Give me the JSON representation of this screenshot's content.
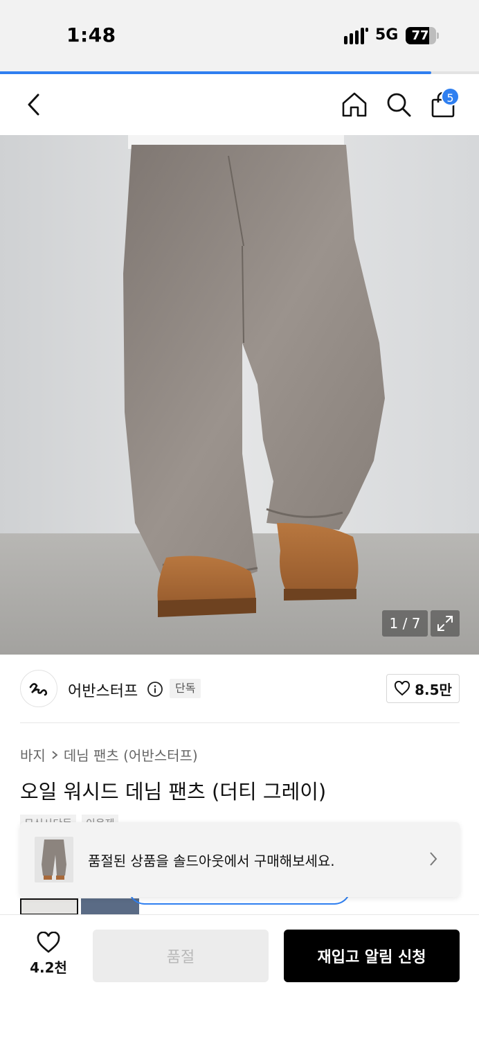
{
  "status_bar": {
    "time": "1:48",
    "network": "5G",
    "battery": "77"
  },
  "page_load_progress": 0.9,
  "navbar": {
    "icons": [
      "back-arrow-icon",
      "home-icon",
      "search-icon",
      "shopping-bag-icon"
    ],
    "cart_badge": "5"
  },
  "gallery": {
    "counter": "1 / 7",
    "expand_icon": "expand-icon"
  },
  "brand": {
    "name": "어반스터프",
    "exclusive_tag": "단독",
    "likes": "8.5만"
  },
  "product": {
    "breadcrumb": [
      "바지",
      "데님 팬츠 (어반스터프)"
    ],
    "title": "오일 워시드 데님 팬츠 (더티 그레이)",
    "tags_partial": [
      "무신사단독",
      "이용제"
    ]
  },
  "soldout_banner": {
    "text": "품절된 상품을 솔드아웃에서 구매해보세요."
  },
  "bottom_bar": {
    "wish_count": "4.2천",
    "soldout_label": "품절",
    "restock_label": "재입고 알림 신청"
  },
  "colors": {
    "accent_blue": "#2f7ff0",
    "primary_black": "#000000",
    "disabled_gray": "#ececec"
  }
}
